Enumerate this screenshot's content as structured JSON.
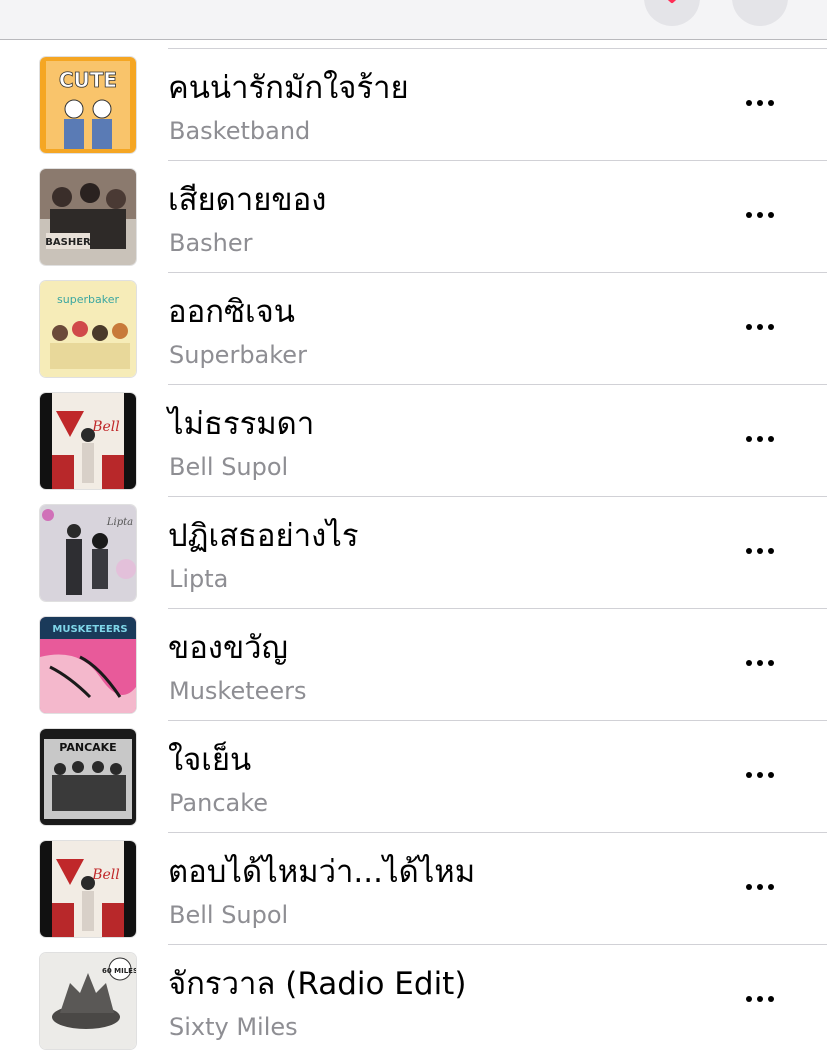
{
  "colors": {
    "accent": "#ff2d55",
    "title": "#000000",
    "subtitle": "#8e8e93",
    "divider": "#d1d1d6"
  },
  "navbar": {
    "back_icon": "chevron-left-icon",
    "download_icon": "download-icon",
    "more_icon": "ellipsis-icon"
  },
  "songs": [
    {
      "title": "คนน่ารักมักใจร้าย",
      "artist": "Basketband",
      "artwork_text": "CUTE"
    },
    {
      "title": "เสียดายของ",
      "artist": "Basher",
      "artwork_text": "BASHER"
    },
    {
      "title": "ออกซิเจน",
      "artist": "Superbaker",
      "artwork_text": "superbaker"
    },
    {
      "title": "ไม่ธรรมดา",
      "artist": "Bell Supol",
      "artwork_text": "Bell"
    },
    {
      "title": "ปฏิเสธอย่างไร",
      "artist": "Lipta",
      "artwork_text": "Lipta"
    },
    {
      "title": "ของขวัญ",
      "artist": "Musketeers",
      "artwork_text": "MUSKETEERS"
    },
    {
      "title": "ใจเย็น",
      "artist": "Pancake",
      "artwork_text": "PANCAKE"
    },
    {
      "title": "ตอบได้ไหมว่า...ได้ไหม",
      "artist": "Bell Supol",
      "artwork_text": "Bell"
    },
    {
      "title": "จักรวาล (Radio Edit)",
      "artist": "Sixty Miles",
      "artwork_text": "60 MILES"
    }
  ]
}
